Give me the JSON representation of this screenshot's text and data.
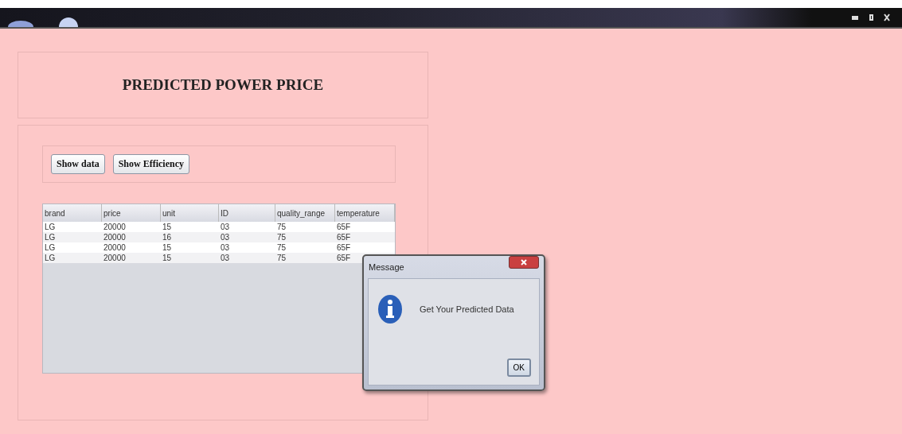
{
  "window": {
    "title": "PREDICTED POWER PRICE"
  },
  "buttons": [
    "Show data",
    "Show Efficiency"
  ],
  "table": {
    "columns": [
      "brand",
      "price",
      "unit",
      "ID",
      "quality_range",
      "temperature"
    ],
    "rows": [
      [
        "LG",
        "20000",
        "15",
        "03",
        "75",
        "65F"
      ],
      [
        "LG",
        "20000",
        "16",
        "03",
        "75",
        "65F"
      ],
      [
        "LG",
        "20000",
        "15",
        "03",
        "75",
        "65F"
      ],
      [
        "LG",
        "20000",
        "15",
        "03",
        "75",
        "65F"
      ]
    ]
  },
  "dialog": {
    "title": "Message",
    "message": "Get Your Predicted Data",
    "button": "OK"
  }
}
